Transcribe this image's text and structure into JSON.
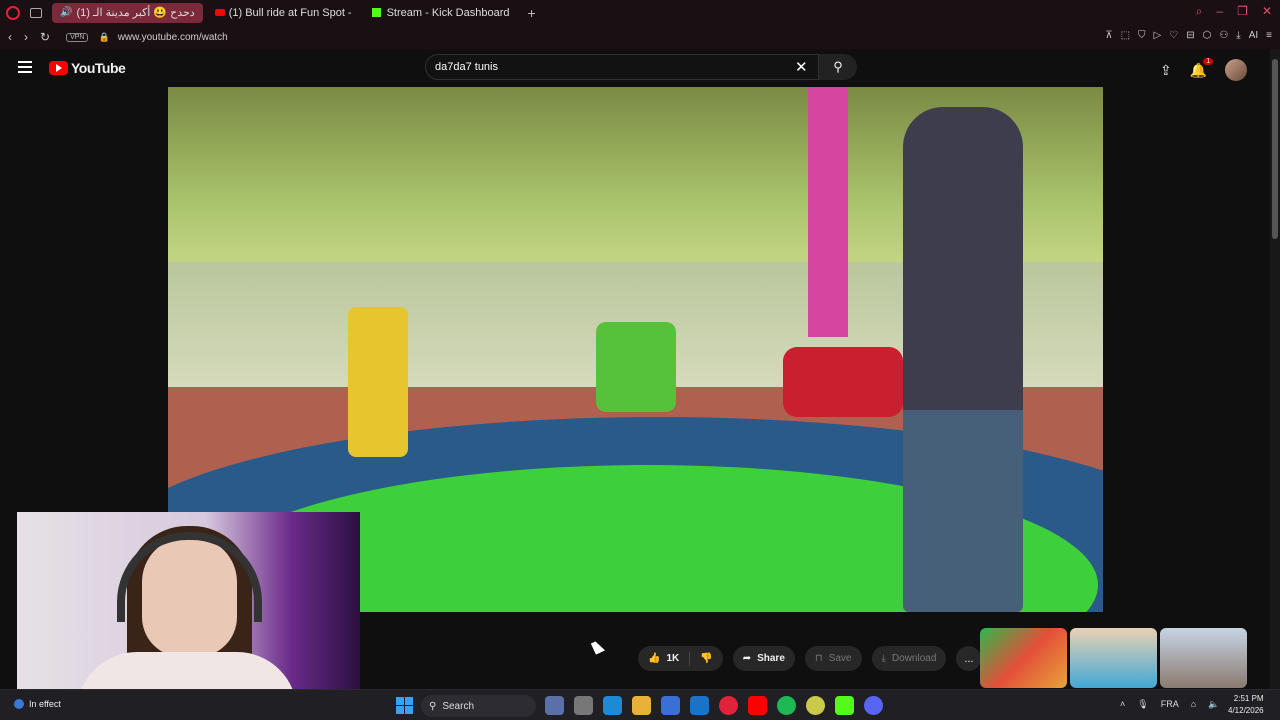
{
  "browser": {
    "tabs": [
      {
        "label": "(1) دحدح 😃 أكبر مدينة الـ",
        "active": true,
        "audio": true,
        "icon": "youtube-icon"
      },
      {
        "label": "(1) Bull ride at Fun Spot -",
        "active": false,
        "icon": "youtube-icon"
      },
      {
        "label": "Stream - Kick Dashboard",
        "active": false,
        "icon": "kick-icon"
      }
    ],
    "new_tab": "+",
    "vpn_label": "VPN",
    "url": "www.youtube.com/watch",
    "ai_label": "AI"
  },
  "youtube": {
    "logo_text": "YouTube",
    "search_value": "da7da7 tunis",
    "notification_count": "1"
  },
  "video_actions": {
    "like_count": "1K",
    "share_label": "Share",
    "save_label": "Save",
    "download_label": "Download",
    "more_label": "..."
  },
  "taskbar": {
    "in_effect_label": "In effect",
    "search_label": "Search",
    "language": "FRA",
    "time": "2:51 PM",
    "date": "4/12/2026"
  },
  "colors": {
    "accent": "#ff0000",
    "opera": "#e0223a",
    "kick": "#53fc18"
  }
}
